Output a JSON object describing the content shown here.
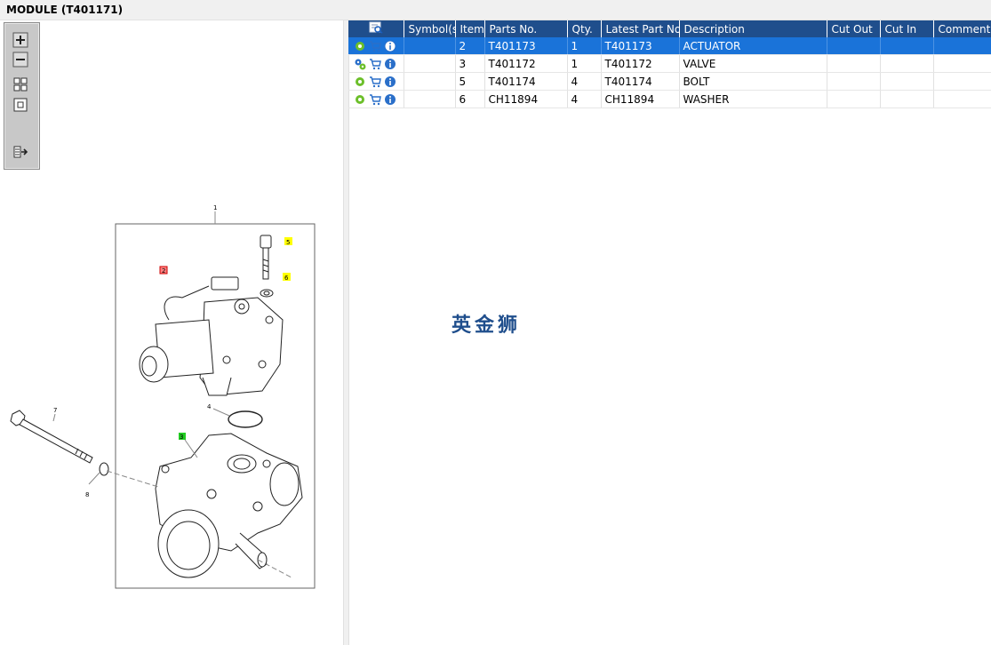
{
  "window": {
    "title": "MODULE (T401171)"
  },
  "toolbar": {
    "buttons": [
      "zoom-in-icon",
      "zoom-out-icon",
      "fit-all-icon",
      "fit-window-icon",
      "export-icon"
    ]
  },
  "table": {
    "columns": [
      "Symbol(s)",
      "Item",
      "Parts No.",
      "Qty.",
      "Latest Part No.",
      "Description",
      "Cut Out",
      "Cut In",
      "Comment"
    ],
    "rows": [
      {
        "item": "2",
        "parts_no": "T401173",
        "qty": "1",
        "latest": "T401173",
        "description": "ACTUATOR",
        "cut_out": "",
        "cut_in": "",
        "comment": "",
        "selected": true
      },
      {
        "item": "3",
        "parts_no": "T401172",
        "qty": "1",
        "latest": "T401172",
        "description": "VALVE",
        "cut_out": "",
        "cut_in": "",
        "comment": "",
        "selected": false
      },
      {
        "item": "5",
        "parts_no": "T401174",
        "qty": "4",
        "latest": "T401174",
        "description": "BOLT",
        "cut_out": "",
        "cut_in": "",
        "comment": "",
        "selected": false
      },
      {
        "item": "6",
        "parts_no": "CH11894",
        "qty": "4",
        "latest": "CH11894",
        "description": "WASHER",
        "cut_out": "",
        "cut_in": "",
        "comment": "",
        "selected": false
      }
    ]
  },
  "diagram": {
    "callouts": {
      "c1": "1",
      "c2": "2",
      "c3": "3",
      "c4": "4",
      "c5": "5",
      "c6": "6",
      "c7": "7",
      "c8": "8"
    }
  },
  "watermark": "英金狮",
  "colors": {
    "header": "#1f4e8c",
    "selected_row": "#1a73d9",
    "highlight_yellow": "#ffff00",
    "highlight_red": "#ff6b6b",
    "highlight_green": "#22cc22"
  }
}
